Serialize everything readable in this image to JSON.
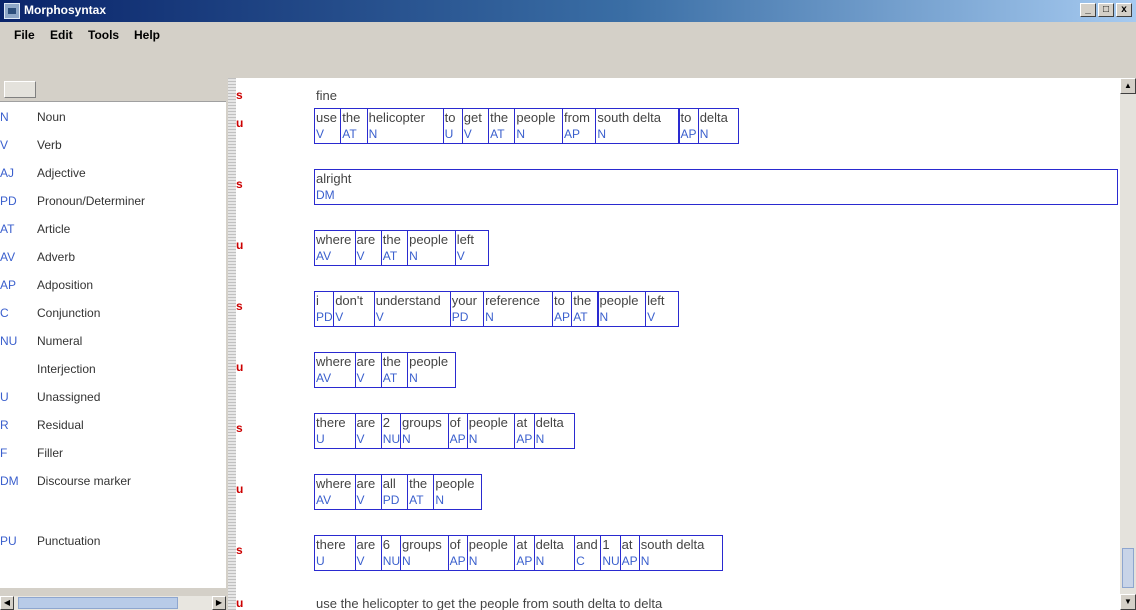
{
  "window": {
    "title": "Morphosyntax",
    "btn_min": "_",
    "btn_max": "□",
    "btn_close": "x"
  },
  "menu": [
    "File",
    "Edit",
    "Tools",
    "Help"
  ],
  "legend": [
    {
      "tag": "N",
      "label": "Noun"
    },
    {
      "tag": "V",
      "label": "Verb"
    },
    {
      "tag": "AJ",
      "label": "Adjective"
    },
    {
      "tag": "PD",
      "label": "Pronoun/Determiner"
    },
    {
      "tag": "AT",
      "label": "Article"
    },
    {
      "tag": "AV",
      "label": "Adverb"
    },
    {
      "tag": "AP",
      "label": "Adposition"
    },
    {
      "tag": "C",
      "label": "Conjunction"
    },
    {
      "tag": "NU",
      "label": "Numeral"
    },
    {
      "tag": "",
      "label": "Interjection"
    },
    {
      "tag": "U",
      "label": "Unassigned"
    },
    {
      "tag": "R",
      "label": "Residual"
    },
    {
      "tag": "F",
      "label": "Filler"
    },
    {
      "tag": "DM",
      "label": "Discourse marker"
    },
    {
      "tag": "PU",
      "label": "Punctuation"
    }
  ],
  "transcript": [
    {
      "speaker": "s",
      "text": "fine"
    },
    {
      "speaker": "u",
      "tokens": [
        {
          "w": "use",
          "t": "V"
        },
        {
          "w": "the",
          "t": "AT"
        },
        {
          "w": "helicopter",
          "t": "N"
        },
        {
          "w": "to",
          "t": "U"
        },
        {
          "w": "get",
          "t": "V"
        },
        {
          "w": "the",
          "t": "AT"
        },
        {
          "w": "people",
          "t": "N"
        },
        {
          "w": "from",
          "t": "AP"
        },
        {
          "w": "south delta",
          "t": "N"
        },
        {
          "w": "to",
          "t": "AP"
        },
        {
          "w": "delta",
          "t": "N"
        }
      ]
    },
    {
      "speaker": "s",
      "wide": true,
      "tokens": [
        {
          "w": "alright",
          "t": "DM"
        }
      ]
    },
    {
      "speaker": "u",
      "tokens": [
        {
          "w": "where",
          "t": "AV"
        },
        {
          "w": "are",
          "t": "V"
        },
        {
          "w": "the",
          "t": "AT"
        },
        {
          "w": "people",
          "t": "N"
        },
        {
          "w": "left",
          "t": "V"
        }
      ]
    },
    {
      "speaker": "s",
      "tokens": [
        {
          "w": "i",
          "t": "PD"
        },
        {
          "w": "don't",
          "t": "V"
        },
        {
          "w": "understand",
          "t": "V"
        },
        {
          "w": "your",
          "t": "PD"
        },
        {
          "w": "reference",
          "t": "N"
        },
        {
          "w": "to",
          "t": "AP"
        },
        {
          "w": "the",
          "t": "AT"
        },
        {
          "w": "people",
          "t": "N"
        },
        {
          "w": "left",
          "t": "V"
        }
      ]
    },
    {
      "speaker": "u",
      "tokens": [
        {
          "w": "where",
          "t": "AV"
        },
        {
          "w": "are",
          "t": "V"
        },
        {
          "w": "the",
          "t": "AT"
        },
        {
          "w": "people",
          "t": "N"
        }
      ]
    },
    {
      "speaker": "s",
      "tokens": [
        {
          "w": "there",
          "t": "U"
        },
        {
          "w": "are",
          "t": "V"
        },
        {
          "w": "2",
          "t": "NU"
        },
        {
          "w": "groups",
          "t": "N"
        },
        {
          "w": "of",
          "t": "AP"
        },
        {
          "w": "people",
          "t": "N"
        },
        {
          "w": "at",
          "t": "AP"
        },
        {
          "w": "delta",
          "t": "N"
        }
      ]
    },
    {
      "speaker": "u",
      "tokens": [
        {
          "w": "where",
          "t": "AV"
        },
        {
          "w": "are",
          "t": "V"
        },
        {
          "w": "all",
          "t": "PD"
        },
        {
          "w": "the",
          "t": "AT"
        },
        {
          "w": "people",
          "t": "N"
        }
      ]
    },
    {
      "speaker": "s",
      "tokens": [
        {
          "w": "there",
          "t": "U"
        },
        {
          "w": "are",
          "t": "V"
        },
        {
          "w": "6",
          "t": "NU"
        },
        {
          "w": "groups",
          "t": "N"
        },
        {
          "w": "of",
          "t": "AP"
        },
        {
          "w": "people",
          "t": "N"
        },
        {
          "w": "at",
          "t": "AP"
        },
        {
          "w": "delta",
          "t": "N"
        },
        {
          "w": "and",
          "t": "C"
        },
        {
          "w": "1",
          "t": "NU"
        },
        {
          "w": "at",
          "t": "AP"
        },
        {
          "w": "south delta",
          "t": "N"
        }
      ]
    },
    {
      "speaker": "u",
      "text": "use the helicopter to get the people from south delta to delta"
    }
  ]
}
